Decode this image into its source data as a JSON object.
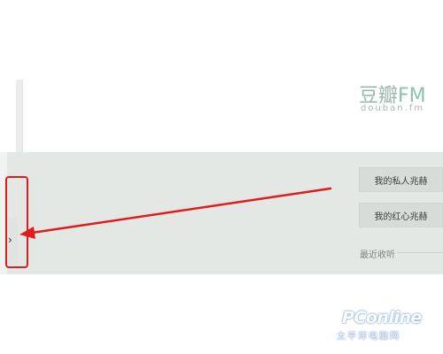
{
  "brand": {
    "name": "豆瓣",
    "fm": "FM",
    "subtitle": "douban.fm"
  },
  "channels": {
    "private": "我的私人兆赫",
    "red_heart": "我的红心兆赫"
  },
  "recent": {
    "label": "最近收听"
  },
  "toggle": {
    "icon": "chevron-right-icon",
    "glyph": "›"
  },
  "annotation": {
    "color": "#e01c1c"
  },
  "watermark": {
    "main": "PConline",
    "sub": "太平洋电脑网"
  }
}
